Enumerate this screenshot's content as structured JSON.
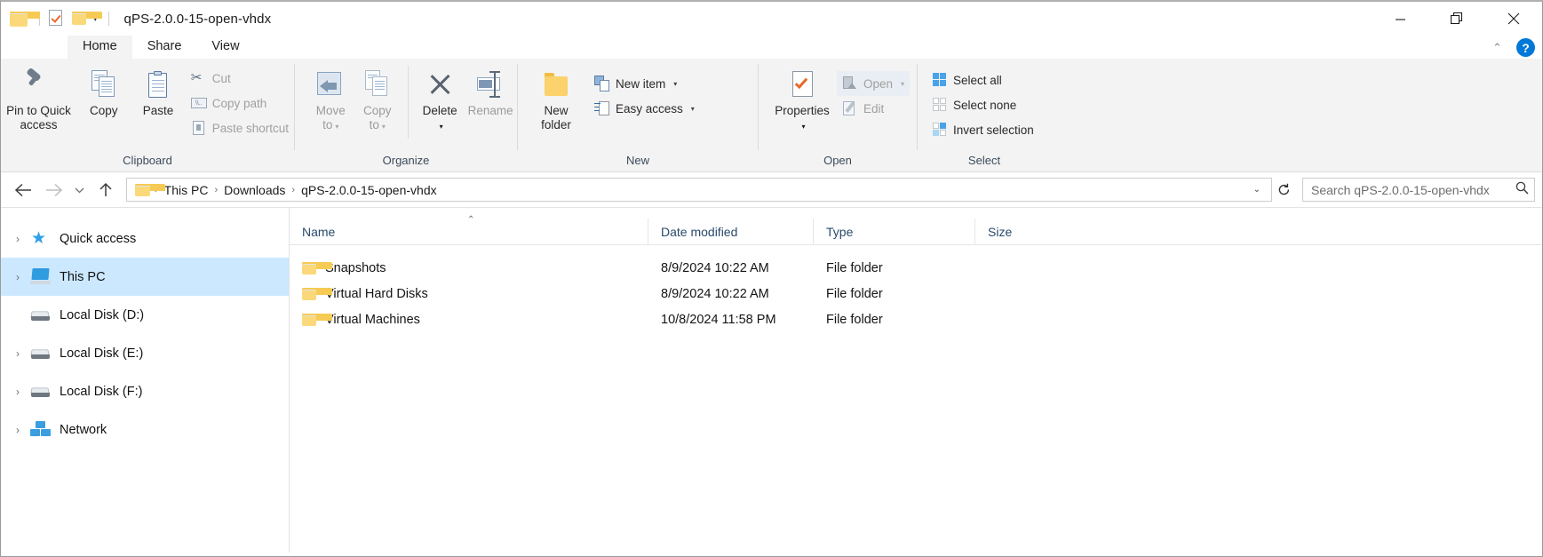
{
  "window": {
    "title": "qPS-2.0.0-15-open-vhdx",
    "controls": {
      "minimize": "minimize-button",
      "maximize": "restore-button",
      "close": "close-button"
    }
  },
  "quick_access_toolbar": {
    "folder_icon": "folder-icon",
    "properties_icon": "properties-icon",
    "new_folder_icon": "new-folder-icon",
    "customize_caret": "▾"
  },
  "tabs": [
    {
      "label": "Home",
      "active": true
    },
    {
      "label": "Share",
      "active": false
    },
    {
      "label": "View",
      "active": false
    }
  ],
  "ribbon_right": {
    "collapse_caret": "⌃",
    "help": "?"
  },
  "ribbon": {
    "groups": [
      {
        "label": "Clipboard",
        "big_buttons": [
          {
            "label": "Pin to Quick\naccess",
            "line1": "Pin to Quick",
            "line2": "access",
            "icon": "pin-icon",
            "disabled": false
          },
          {
            "label": "Copy",
            "line1": "Copy",
            "line2": "",
            "icon": "copy-icon",
            "disabled": false
          },
          {
            "label": "Paste",
            "line1": "Paste",
            "line2": "",
            "icon": "paste-icon",
            "disabled": false
          }
        ],
        "small_buttons": [
          {
            "label": "Cut",
            "icon": "scissors-icon",
            "disabled": true
          },
          {
            "label": "Copy path",
            "icon": "copy-path-icon",
            "disabled": true
          },
          {
            "label": "Paste shortcut",
            "icon": "paste-shortcut-icon",
            "disabled": true
          }
        ]
      },
      {
        "label": "Organize",
        "big_buttons": [
          {
            "line1": "Move",
            "line2": "to",
            "icon": "move-to-icon",
            "caret": "▾",
            "disabled": true
          },
          {
            "line1": "Copy",
            "line2": "to",
            "icon": "copy-to-icon",
            "caret": "▾",
            "disabled": true
          },
          {
            "line1": "Delete",
            "line2": "",
            "icon": "delete-icon",
            "caret": "▾",
            "disabled": false
          },
          {
            "line1": "Rename",
            "line2": "",
            "icon": "rename-icon",
            "caret": "",
            "disabled": true
          }
        ]
      },
      {
        "label": "New",
        "big_buttons": [
          {
            "line1": "New",
            "line2": "folder",
            "icon": "new-folder-icon",
            "disabled": false
          }
        ],
        "small_buttons": [
          {
            "label": "New item",
            "icon": "new-item-icon",
            "caret": "▾",
            "disabled": false
          },
          {
            "label": "Easy access",
            "icon": "easy-access-icon",
            "caret": "▾",
            "disabled": false
          }
        ]
      },
      {
        "label": "Open",
        "big_buttons": [
          {
            "line1": "Properties",
            "line2": "",
            "icon": "properties-icon",
            "caret": "▾",
            "disabled": false
          }
        ],
        "small_buttons": [
          {
            "label": "Open",
            "icon": "open-icon",
            "caret": "▾",
            "disabled": true
          },
          {
            "label": "Edit",
            "icon": "edit-icon",
            "caret": "",
            "disabled": true
          }
        ]
      },
      {
        "label": "Select",
        "small_buttons": [
          {
            "label": "Select all",
            "icon": "select-all-icon",
            "disabled": false
          },
          {
            "label": "Select none",
            "icon": "select-none-icon",
            "disabled": false
          },
          {
            "label": "Invert selection",
            "icon": "invert-selection-icon",
            "disabled": false
          }
        ]
      }
    ]
  },
  "navbar": {
    "back": "back-arrow-icon",
    "forward": "forward-arrow-icon",
    "recent": "recent-locations-caret",
    "up": "up-arrow-icon",
    "address_folder_icon": "folder-icon",
    "breadcrumbs": [
      "This PC",
      "Downloads",
      "qPS-2.0.0-15-open-vhdx"
    ],
    "separator": "›",
    "dropdown_caret": "⌄",
    "refresh": "refresh-icon",
    "search_placeholder": "Search qPS-2.0.0-15-open-vhdx",
    "search_value": "",
    "search_icon": "search-icon"
  },
  "nav_pane": {
    "items": [
      {
        "label": "Quick access",
        "icon": "star-icon",
        "expander": "›",
        "indent": false,
        "selected": false
      },
      {
        "label": "This PC",
        "icon": "this-pc-icon",
        "expander": "›",
        "indent": false,
        "selected": true
      },
      {
        "label": "Local Disk (D:)",
        "icon": "drive-icon",
        "expander": "",
        "indent": true,
        "selected": false
      },
      {
        "label": "Local Disk (E:)",
        "icon": "drive-icon",
        "expander": "›",
        "indent": false,
        "selected": false
      },
      {
        "label": "Local Disk (F:)",
        "icon": "drive-icon",
        "expander": "›",
        "indent": false,
        "selected": false
      },
      {
        "label": "Network",
        "icon": "network-icon",
        "expander": "›",
        "indent": false,
        "selected": false
      }
    ]
  },
  "file_list": {
    "columns": [
      {
        "label": "Name",
        "sorted": true,
        "sort_glyph": "⌃"
      },
      {
        "label": "Date modified",
        "sorted": false,
        "sort_glyph": ""
      },
      {
        "label": "Type",
        "sorted": false,
        "sort_glyph": ""
      },
      {
        "label": "Size",
        "sorted": false,
        "sort_glyph": ""
      }
    ],
    "rows": [
      {
        "name": "Snapshots",
        "date": "8/9/2024 10:22 AM",
        "type": "File folder",
        "size": "",
        "icon": "folder-icon"
      },
      {
        "name": "Virtual Hard Disks",
        "date": "8/9/2024 10:22 AM",
        "type": "File folder",
        "size": "",
        "icon": "folder-icon"
      },
      {
        "name": "Virtual Machines",
        "date": "10/8/2024 11:58 PM",
        "type": "File folder",
        "size": "",
        "icon": "folder-icon"
      }
    ]
  },
  "colors": {
    "accent": "#0078d7",
    "selection": "#cce8ff",
    "ribbon_bg": "#f3f3f3",
    "folder_yellow": "#fbd26c",
    "orange_check": "#e8692a"
  }
}
